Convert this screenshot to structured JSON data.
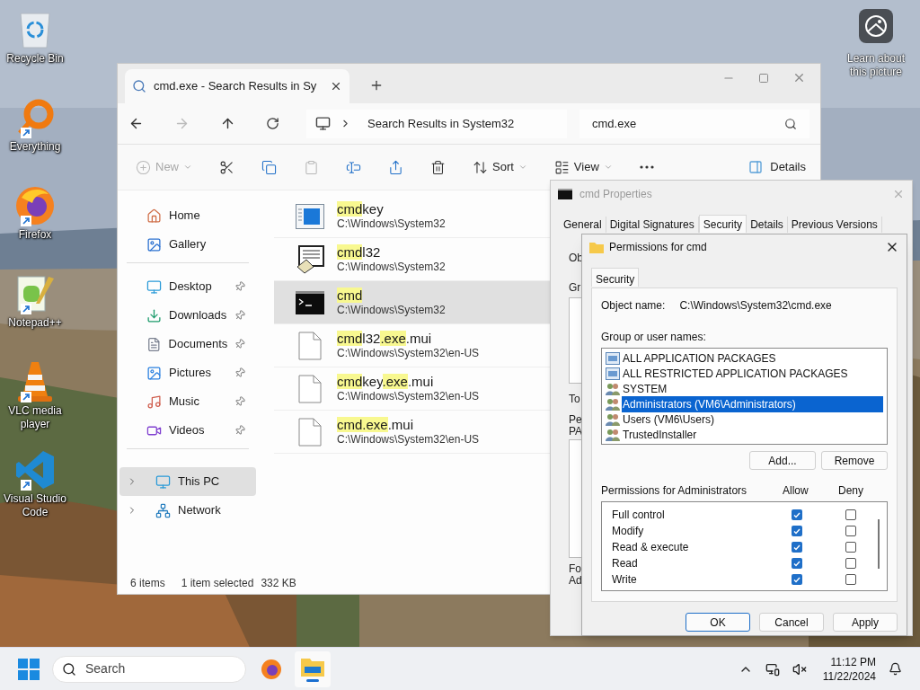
{
  "desktop_icons": [
    {
      "label": "Recycle Bin",
      "kind": "recycle",
      "shortcut": false
    },
    {
      "label": "Everything",
      "kind": "everything",
      "shortcut": true
    },
    {
      "label": "Firefox",
      "kind": "firefox",
      "shortcut": true
    },
    {
      "label": "Notepad++",
      "kind": "notepad",
      "shortcut": true
    },
    {
      "label": "VLC media player",
      "kind": "vlc",
      "shortcut": true
    },
    {
      "label": "Visual Studio Code",
      "kind": "vscode",
      "shortcut": true
    }
  ],
  "learn_more": {
    "label": "Learn about this picture"
  },
  "explorer": {
    "tab_title": "cmd.exe - Search Results in Sy",
    "address": "Search Results in System32",
    "search": "cmd.exe",
    "toolbar": [
      {
        "kind": "new",
        "label": "New",
        "disabled": true,
        "dropdown": true
      },
      {
        "kind": "cut",
        "disabled": false,
        "dropdown": false
      },
      {
        "kind": "copy",
        "disabled": false,
        "dropdown": false
      },
      {
        "kind": "paste",
        "disabled": true,
        "dropdown": false
      },
      {
        "kind": "rename",
        "disabled": false,
        "dropdown": false
      },
      {
        "kind": "share",
        "disabled": false,
        "dropdown": false
      },
      {
        "kind": "delete",
        "disabled": false,
        "dropdown": false
      },
      {
        "kind": "sort",
        "label": "Sort",
        "disabled": false,
        "dropdown": true
      },
      {
        "kind": "view",
        "label": "View",
        "disabled": false,
        "dropdown": true
      },
      {
        "kind": "more",
        "disabled": false,
        "dropdown": false
      }
    ],
    "details_label": "Details",
    "sidebar": [
      [
        {
          "label": "Home",
          "kind": "home",
          "pinned": false,
          "expandable": false,
          "selected": false
        },
        {
          "label": "Gallery",
          "kind": "gallery",
          "pinned": false,
          "expandable": false,
          "selected": false
        }
      ],
      [
        {
          "label": "Desktop",
          "kind": "desktop",
          "pinned": true,
          "expandable": false,
          "selected": false
        },
        {
          "label": "Downloads",
          "kind": "downloads",
          "pinned": true,
          "expandable": false,
          "selected": false
        },
        {
          "label": "Documents",
          "kind": "documents",
          "pinned": true,
          "expandable": false,
          "selected": false
        },
        {
          "label": "Pictures",
          "kind": "pictures",
          "pinned": true,
          "expandable": false,
          "selected": false
        },
        {
          "label": "Music",
          "kind": "music",
          "pinned": true,
          "expandable": false,
          "selected": false
        },
        {
          "label": "Videos",
          "kind": "videos",
          "pinned": true,
          "expandable": false,
          "selected": false
        }
      ],
      [
        {
          "label": "This PC",
          "kind": "pc",
          "pinned": false,
          "expandable": true,
          "selected": true
        },
        {
          "label": "Network",
          "kind": "network",
          "pinned": false,
          "expandable": true,
          "selected": false
        }
      ]
    ],
    "files": [
      {
        "kind": "app",
        "selected": false,
        "name": [
          {
            "text": "cmd",
            "match": true
          },
          {
            "text": "key",
            "match": false
          }
        ],
        "path": "C:\\Windows\\System32"
      },
      {
        "kind": "dialer",
        "selected": false,
        "name": [
          {
            "text": "cmd",
            "match": true
          },
          {
            "text": "l32",
            "match": false
          }
        ],
        "path": "C:\\Windows\\System32"
      },
      {
        "kind": "console",
        "selected": true,
        "name": [
          {
            "text": "cmd",
            "match": true
          }
        ],
        "path": "C:\\Windows\\System32"
      },
      {
        "kind": "file",
        "selected": false,
        "name": [
          {
            "text": "cmd",
            "match": true
          },
          {
            "text": "l32",
            "match": false
          },
          {
            "text": ".exe",
            "match": true
          },
          {
            "text": ".mui",
            "match": false
          }
        ],
        "path": "C:\\Windows\\System32\\en-US"
      },
      {
        "kind": "file",
        "selected": false,
        "name": [
          {
            "text": "cmd",
            "match": true
          },
          {
            "text": "key",
            "match": false
          },
          {
            "text": ".exe",
            "match": true
          },
          {
            "text": ".mui",
            "match": false
          }
        ],
        "path": "C:\\Windows\\System32\\en-US"
      },
      {
        "kind": "file",
        "selected": false,
        "name": [
          {
            "text": "cmd.exe",
            "match": true
          },
          {
            "text": ".mui",
            "match": false
          }
        ],
        "path": "C:\\Windows\\System32\\en-US"
      }
    ],
    "status": [
      "6 items",
      "1 item selected",
      "332 KB"
    ]
  },
  "properties": {
    "title": "cmd Properties",
    "tabs": [
      {
        "label": "General",
        "selected": false
      },
      {
        "label": "Digital Signatures",
        "selected": false
      },
      {
        "label": "Security",
        "selected": true
      },
      {
        "label": "Details",
        "selected": false
      },
      {
        "label": "Previous Versions",
        "selected": false
      }
    ],
    "partial_labels": [
      "Ob",
      "Gr",
      "To",
      "Pe",
      "PA",
      "Fo",
      "Ad"
    ]
  },
  "permissions": {
    "title": "Permissions for cmd",
    "tab": "Security",
    "object_label": "Object name:",
    "object_value": "C:\\Windows\\System32\\cmd.exe",
    "group_label": "Group or user names:",
    "principals": [
      {
        "name": "ALL APPLICATION PACKAGES",
        "kind": "package",
        "selected": false
      },
      {
        "name": "ALL RESTRICTED APPLICATION PACKAGES",
        "kind": "package",
        "selected": false
      },
      {
        "name": "SYSTEM",
        "kind": "group",
        "selected": false
      },
      {
        "name": "Administrators (VM6\\Administrators)",
        "kind": "group",
        "selected": true
      },
      {
        "name": "Users (VM6\\Users)",
        "kind": "group",
        "selected": false
      },
      {
        "name": "TrustedInstaller",
        "kind": "group",
        "selected": false
      }
    ],
    "add_button": "Add...",
    "remove_button": "Remove",
    "perm_label": "Permissions for Administrators",
    "allow_label": "Allow",
    "deny_label": "Deny",
    "perms": [
      {
        "name": "Full control",
        "allow": true,
        "deny": false
      },
      {
        "name": "Modify",
        "allow": true,
        "deny": false
      },
      {
        "name": "Read & execute",
        "allow": true,
        "deny": false
      },
      {
        "name": "Read",
        "allow": true,
        "deny": false
      },
      {
        "name": "Write",
        "allow": true,
        "deny": false
      }
    ],
    "buttons": [
      {
        "label": "OK",
        "default": true
      },
      {
        "label": "Cancel",
        "default": false
      },
      {
        "label": "Apply",
        "default": false
      }
    ]
  },
  "taskbar": {
    "search_placeholder": "Search",
    "apps": [
      {
        "kind": "firefox",
        "active": false
      },
      {
        "kind": "explorer",
        "active": true
      }
    ],
    "time": "11:12 PM",
    "date": "11/22/2024"
  }
}
